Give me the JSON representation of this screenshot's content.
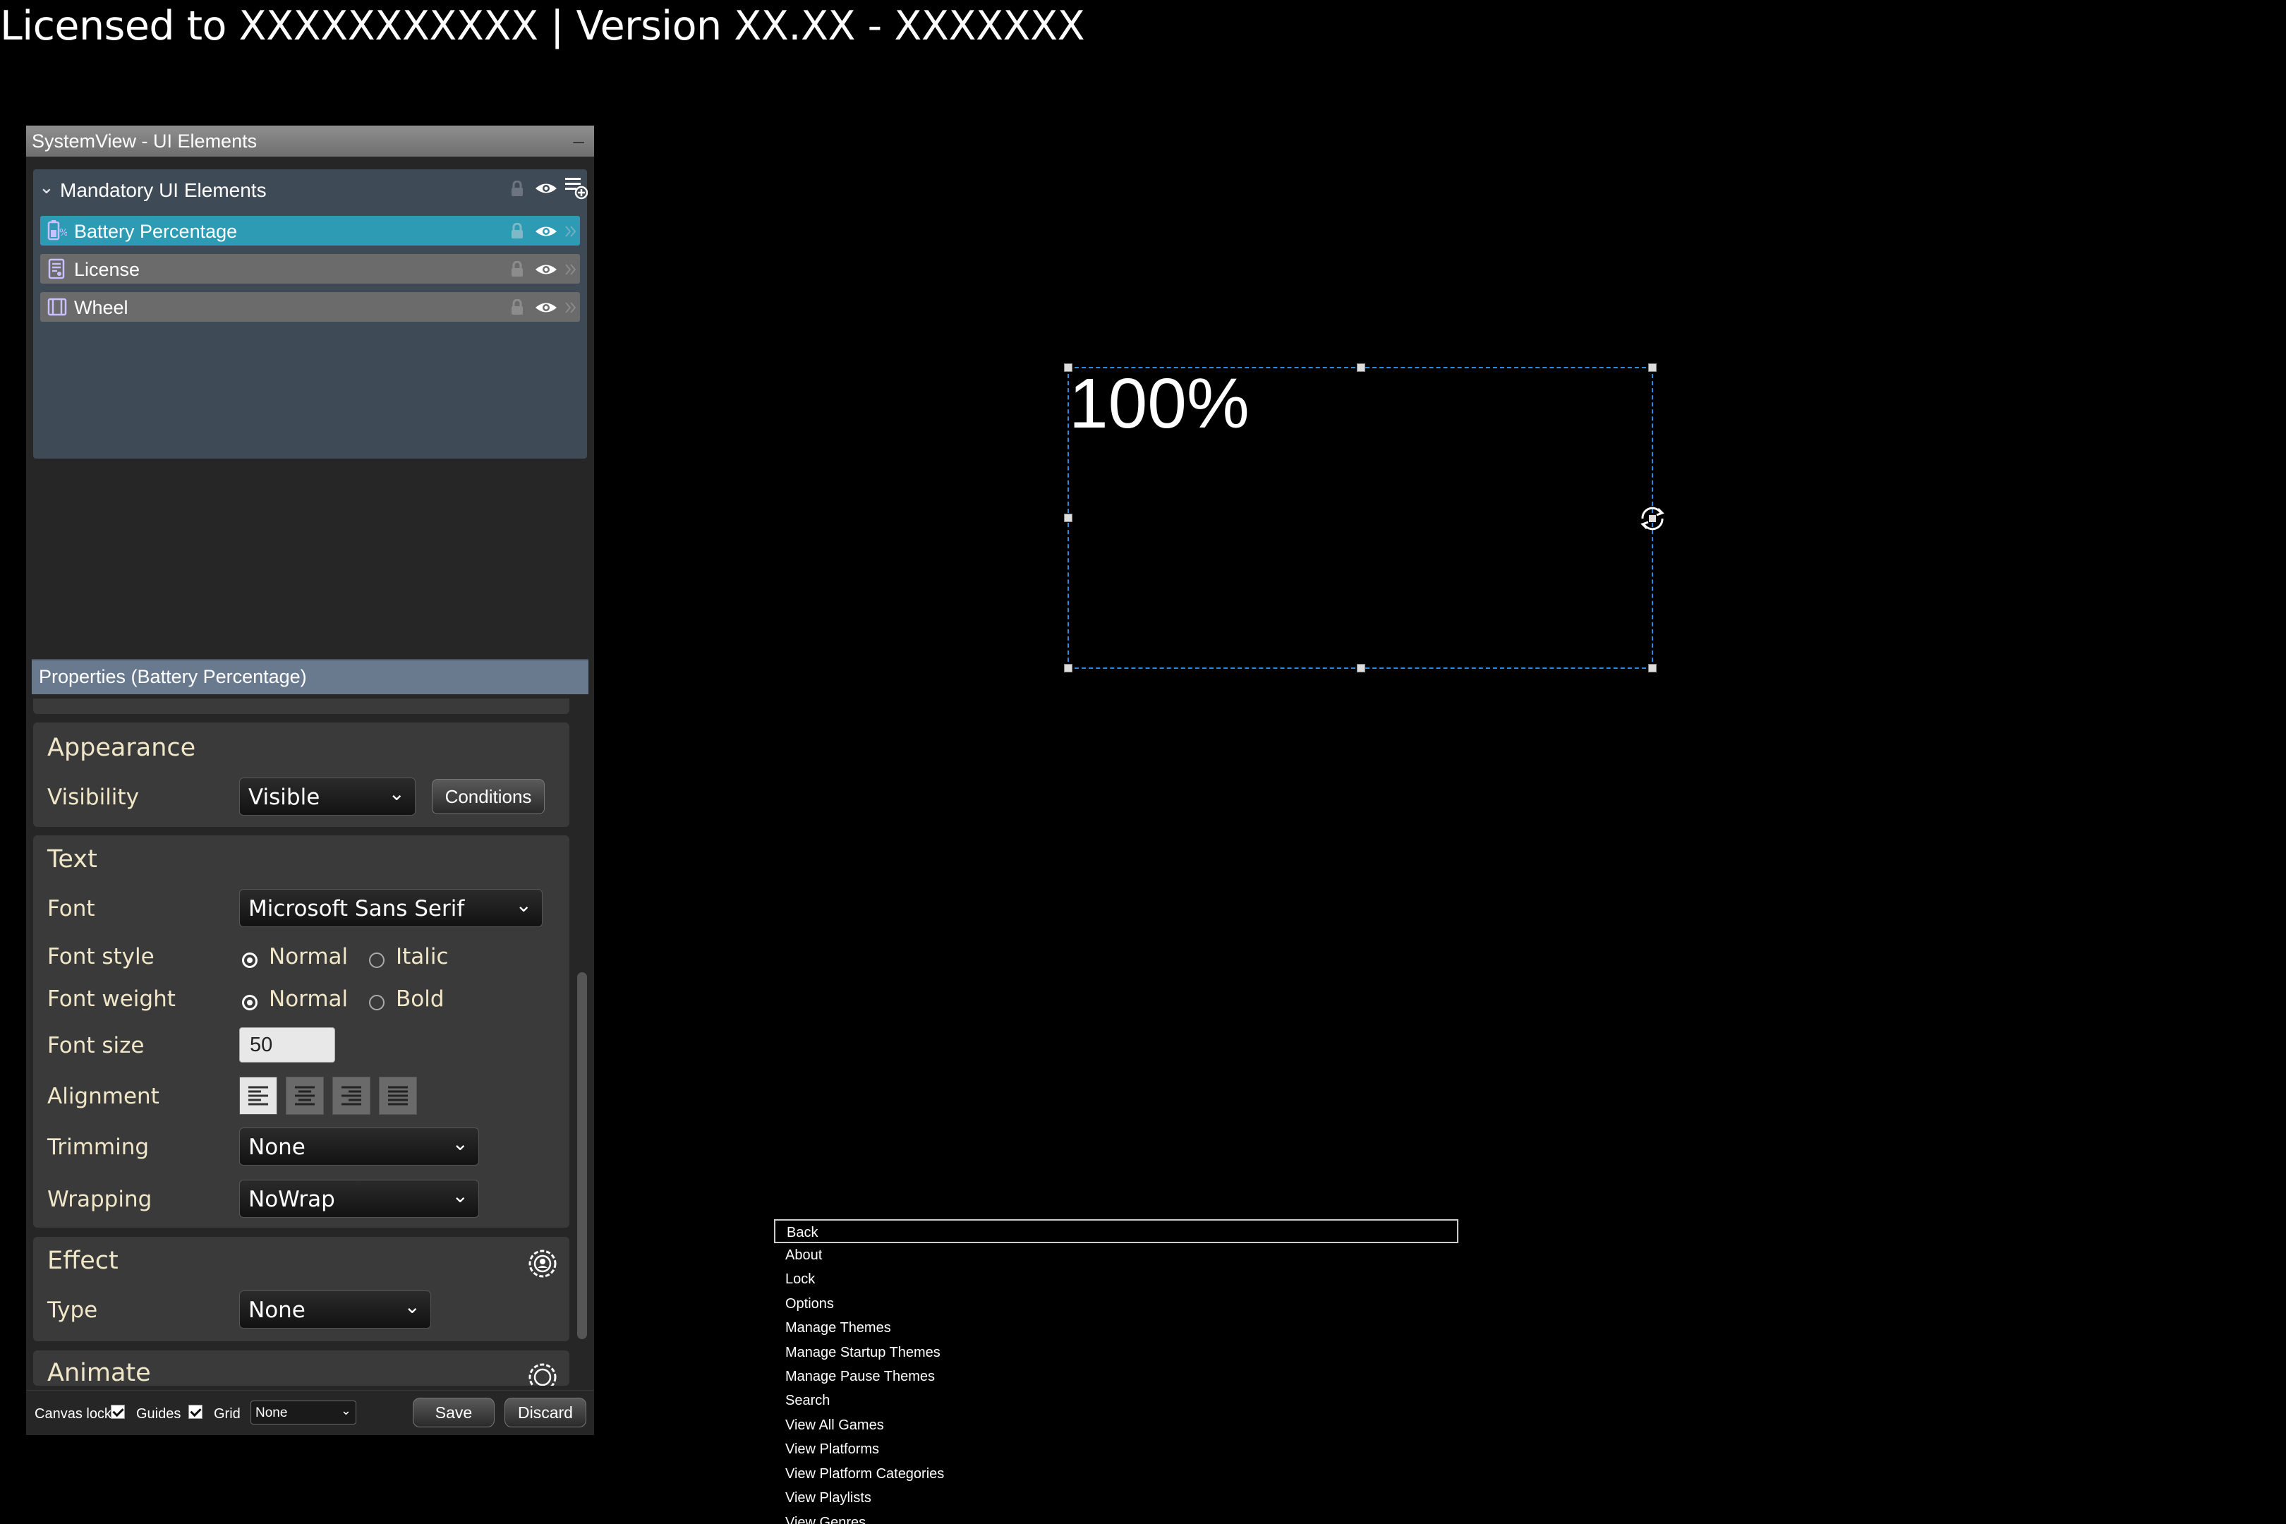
{
  "banner": {
    "text": "Licensed to XXXXXXXXXXX | Version XX.XX - XXXXXXX"
  },
  "systemview": {
    "title": "SystemView - UI Elements",
    "minimize": "–",
    "group": {
      "title": "Mandatory UI Elements",
      "items": [
        {
          "label": "Battery Percentage",
          "selected": true,
          "icon": "battery-percentage-icon"
        },
        {
          "label": "License",
          "selected": false,
          "icon": "license-icon"
        },
        {
          "label": "Wheel",
          "selected": false,
          "icon": "wheel-icon"
        }
      ]
    }
  },
  "properties": {
    "header": "Properties (Battery Percentage)",
    "appearance": {
      "title": "Appearance",
      "visibility_label": "Visibility",
      "visibility_value": "Visible",
      "conditions_label": "Conditions"
    },
    "text": {
      "title": "Text",
      "font_label": "Font",
      "font_value": "Microsoft Sans Serif",
      "font_style_label": "Font style",
      "style_normal": "Normal",
      "style_italic": "Italic",
      "font_weight_label": "Font weight",
      "weight_normal": "Normal",
      "weight_bold": "Bold",
      "font_size_label": "Font size",
      "font_size_value": "50",
      "alignment_label": "Alignment",
      "trimming_label": "Trimming",
      "trimming_value": "None",
      "wrapping_label": "Wrapping",
      "wrapping_value": "NoWrap"
    },
    "effect": {
      "title": "Effect",
      "type_label": "Type",
      "type_value": "None"
    },
    "animate": {
      "title": "Animate"
    }
  },
  "bottom_bar": {
    "canvas_lock_label": "Canvas lock",
    "guides_label": "Guides",
    "grid_label": "Grid",
    "grid_value": "None",
    "save_label": "Save",
    "discard_label": "Discard"
  },
  "canvas": {
    "battery_text": "100%"
  },
  "menu": {
    "items": [
      "Back",
      "About",
      "Lock",
      "Options",
      "Manage Themes",
      "Manage Startup Themes",
      "Manage Pause Themes",
      "Search",
      "View All Games",
      "View Platforms",
      "View Platform Categories",
      "View Playlists",
      "View Genres"
    ]
  }
}
